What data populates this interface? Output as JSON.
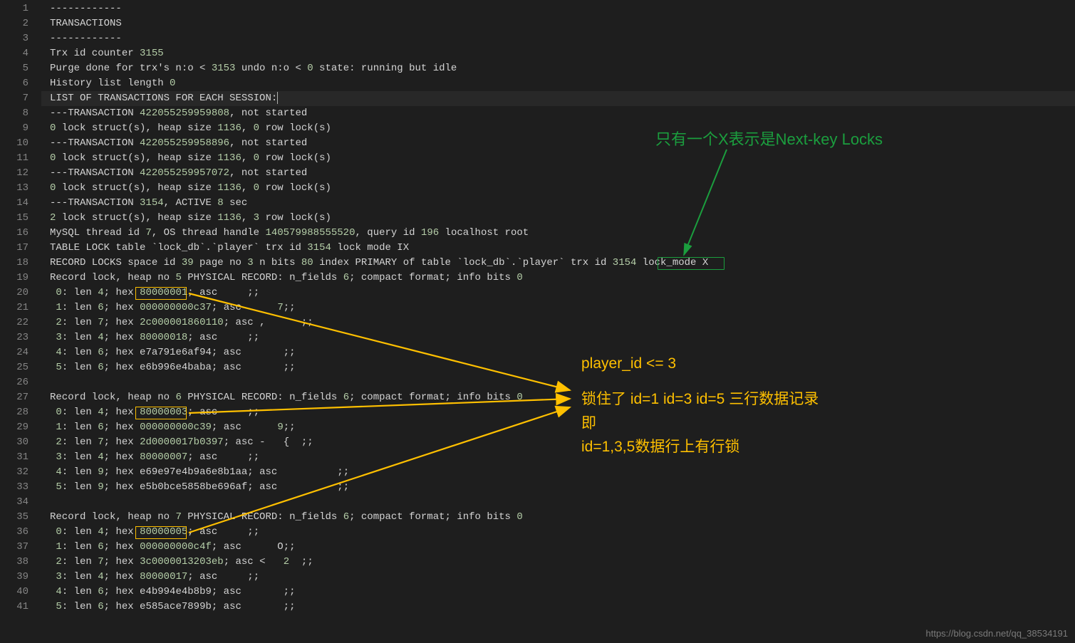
{
  "lines": [
    {
      "n": 1,
      "tokens": [
        {
          "t": "------------",
          "c": "c-default"
        }
      ]
    },
    {
      "n": 2,
      "tokens": [
        {
          "t": "TRANSACTIONS",
          "c": "c-default"
        }
      ]
    },
    {
      "n": 3,
      "tokens": [
        {
          "t": "------------",
          "c": "c-default"
        }
      ]
    },
    {
      "n": 4,
      "tokens": [
        {
          "t": "Trx id counter ",
          "c": "c-default"
        },
        {
          "t": "3155",
          "c": "c-num"
        }
      ]
    },
    {
      "n": 5,
      "tokens": [
        {
          "t": "Purge done for trx's n:o < ",
          "c": "c-default"
        },
        {
          "t": "3153",
          "c": "c-num"
        },
        {
          "t": " undo n:o < ",
          "c": "c-default"
        },
        {
          "t": "0",
          "c": "c-num"
        },
        {
          "t": " state: running but idle",
          "c": "c-default"
        }
      ]
    },
    {
      "n": 6,
      "tokens": [
        {
          "t": "History list length ",
          "c": "c-default"
        },
        {
          "t": "0",
          "c": "c-num"
        }
      ]
    },
    {
      "n": 7,
      "active": true,
      "cursor": true,
      "tokens": [
        {
          "t": "LIST OF TRANSACTIONS FOR EACH SESSION:",
          "c": "c-default"
        }
      ]
    },
    {
      "n": 8,
      "tokens": [
        {
          "t": "---TRANSACTION ",
          "c": "c-default"
        },
        {
          "t": "422055259959808",
          "c": "c-num"
        },
        {
          "t": ", not started",
          "c": "c-default"
        }
      ]
    },
    {
      "n": 9,
      "tokens": [
        {
          "t": "0",
          "c": "c-num"
        },
        {
          "t": " lock struct(s), heap size ",
          "c": "c-default"
        },
        {
          "t": "1136",
          "c": "c-num"
        },
        {
          "t": ", ",
          "c": "c-default"
        },
        {
          "t": "0",
          "c": "c-num"
        },
        {
          "t": " row lock(s)",
          "c": "c-default"
        }
      ]
    },
    {
      "n": 10,
      "tokens": [
        {
          "t": "---TRANSACTION ",
          "c": "c-default"
        },
        {
          "t": "422055259958896",
          "c": "c-num"
        },
        {
          "t": ", not started",
          "c": "c-default"
        }
      ]
    },
    {
      "n": 11,
      "tokens": [
        {
          "t": "0",
          "c": "c-num"
        },
        {
          "t": " lock struct(s), heap size ",
          "c": "c-default"
        },
        {
          "t": "1136",
          "c": "c-num"
        },
        {
          "t": ", ",
          "c": "c-default"
        },
        {
          "t": "0",
          "c": "c-num"
        },
        {
          "t": " row lock(s)",
          "c": "c-default"
        }
      ]
    },
    {
      "n": 12,
      "tokens": [
        {
          "t": "---TRANSACTION ",
          "c": "c-default"
        },
        {
          "t": "422055259957072",
          "c": "c-num"
        },
        {
          "t": ", not started",
          "c": "c-default"
        }
      ]
    },
    {
      "n": 13,
      "tokens": [
        {
          "t": "0",
          "c": "c-num"
        },
        {
          "t": " lock struct(s), heap size ",
          "c": "c-default"
        },
        {
          "t": "1136",
          "c": "c-num"
        },
        {
          "t": ", ",
          "c": "c-default"
        },
        {
          "t": "0",
          "c": "c-num"
        },
        {
          "t": " row lock(s)",
          "c": "c-default"
        }
      ]
    },
    {
      "n": 14,
      "tokens": [
        {
          "t": "---TRANSACTION ",
          "c": "c-default"
        },
        {
          "t": "3154",
          "c": "c-num"
        },
        {
          "t": ", ACTIVE ",
          "c": "c-default"
        },
        {
          "t": "8",
          "c": "c-num"
        },
        {
          "t": " sec",
          "c": "c-default"
        }
      ]
    },
    {
      "n": 15,
      "tokens": [
        {
          "t": "2",
          "c": "c-num"
        },
        {
          "t": " lock struct(s), heap size ",
          "c": "c-default"
        },
        {
          "t": "1136",
          "c": "c-num"
        },
        {
          "t": ", ",
          "c": "c-default"
        },
        {
          "t": "3",
          "c": "c-num"
        },
        {
          "t": " row lock(s)",
          "c": "c-default"
        }
      ]
    },
    {
      "n": 16,
      "tokens": [
        {
          "t": "MySQL thread id ",
          "c": "c-default"
        },
        {
          "t": "7",
          "c": "c-num"
        },
        {
          "t": ", OS thread handle ",
          "c": "c-default"
        },
        {
          "t": "140579988555520",
          "c": "c-num"
        },
        {
          "t": ", query id ",
          "c": "c-default"
        },
        {
          "t": "196",
          "c": "c-num"
        },
        {
          "t": " localhost root",
          "c": "c-default"
        }
      ]
    },
    {
      "n": 17,
      "tokens": [
        {
          "t": "TABLE LOCK table `lock_db`.`player` trx id ",
          "c": "c-default"
        },
        {
          "t": "3154",
          "c": "c-num"
        },
        {
          "t": " lock mode IX",
          "c": "c-default"
        }
      ]
    },
    {
      "n": 18,
      "tokens": [
        {
          "t": "RECORD LOCKS space id ",
          "c": "c-default"
        },
        {
          "t": "39",
          "c": "c-num"
        },
        {
          "t": " page no ",
          "c": "c-default"
        },
        {
          "t": "3",
          "c": "c-num"
        },
        {
          "t": " n bits ",
          "c": "c-default"
        },
        {
          "t": "80",
          "c": "c-num"
        },
        {
          "t": " index PRIMARY of table `lock_db`.`player` trx id ",
          "c": "c-default"
        },
        {
          "t": "3154",
          "c": "c-num"
        },
        {
          "t": " lock_mode X",
          "c": "c-default"
        }
      ]
    },
    {
      "n": 19,
      "tokens": [
        {
          "t": "Record lock, heap no ",
          "c": "c-default"
        },
        {
          "t": "5",
          "c": "c-num"
        },
        {
          "t": " PHYSICAL RECORD: n_fields ",
          "c": "c-default"
        },
        {
          "t": "6",
          "c": "c-num"
        },
        {
          "t": "; compact format; info bits ",
          "c": "c-default"
        },
        {
          "t": "0",
          "c": "c-num"
        }
      ]
    },
    {
      "n": 20,
      "tokens": [
        {
          "t": " ",
          "c": "c-default"
        },
        {
          "t": "0",
          "c": "c-num"
        },
        {
          "t": ": len ",
          "c": "c-default"
        },
        {
          "t": "4",
          "c": "c-num"
        },
        {
          "t": "; hex ",
          "c": "c-default"
        },
        {
          "t": "80000001",
          "c": "c-num"
        },
        {
          "t": "; asc     ;;",
          "c": "c-default"
        }
      ]
    },
    {
      "n": 21,
      "tokens": [
        {
          "t": " ",
          "c": "c-default"
        },
        {
          "t": "1",
          "c": "c-num"
        },
        {
          "t": ": len ",
          "c": "c-default"
        },
        {
          "t": "6",
          "c": "c-num"
        },
        {
          "t": "; hex ",
          "c": "c-default"
        },
        {
          "t": "000000000c37",
          "c": "c-num"
        },
        {
          "t": "; asc      ",
          "c": "c-default"
        },
        {
          "t": "7",
          "c": "c-num"
        },
        {
          "t": ";;",
          "c": "c-default"
        }
      ]
    },
    {
      "n": 22,
      "tokens": [
        {
          "t": " ",
          "c": "c-default"
        },
        {
          "t": "2",
          "c": "c-num"
        },
        {
          "t": ": len ",
          "c": "c-default"
        },
        {
          "t": "7",
          "c": "c-num"
        },
        {
          "t": "; hex ",
          "c": "c-default"
        },
        {
          "t": "2c000001860110",
          "c": "c-num"
        },
        {
          "t": "; asc ,      ;;",
          "c": "c-default"
        }
      ]
    },
    {
      "n": 23,
      "tokens": [
        {
          "t": " ",
          "c": "c-default"
        },
        {
          "t": "3",
          "c": "c-num"
        },
        {
          "t": ": len ",
          "c": "c-default"
        },
        {
          "t": "4",
          "c": "c-num"
        },
        {
          "t": "; hex ",
          "c": "c-default"
        },
        {
          "t": "80000018",
          "c": "c-num"
        },
        {
          "t": "; asc     ;;",
          "c": "c-default"
        }
      ]
    },
    {
      "n": 24,
      "tokens": [
        {
          "t": " ",
          "c": "c-default"
        },
        {
          "t": "4",
          "c": "c-num"
        },
        {
          "t": ": len ",
          "c": "c-default"
        },
        {
          "t": "6",
          "c": "c-num"
        },
        {
          "t": "; hex e7a791e6af94; asc       ;;",
          "c": "c-default"
        }
      ]
    },
    {
      "n": 25,
      "tokens": [
        {
          "t": " ",
          "c": "c-default"
        },
        {
          "t": "5",
          "c": "c-num"
        },
        {
          "t": ": len ",
          "c": "c-default"
        },
        {
          "t": "6",
          "c": "c-num"
        },
        {
          "t": "; hex e6b996e4baba; asc       ;;",
          "c": "c-default"
        }
      ]
    },
    {
      "n": 26,
      "tokens": []
    },
    {
      "n": 27,
      "tokens": [
        {
          "t": "Record lock, heap no ",
          "c": "c-default"
        },
        {
          "t": "6",
          "c": "c-num"
        },
        {
          "t": " PHYSICAL RECORD: n_fields ",
          "c": "c-default"
        },
        {
          "t": "6",
          "c": "c-num"
        },
        {
          "t": "; compact format; info bits ",
          "c": "c-default"
        },
        {
          "t": "0",
          "c": "c-num"
        }
      ]
    },
    {
      "n": 28,
      "tokens": [
        {
          "t": " ",
          "c": "c-default"
        },
        {
          "t": "0",
          "c": "c-num"
        },
        {
          "t": ": len ",
          "c": "c-default"
        },
        {
          "t": "4",
          "c": "c-num"
        },
        {
          "t": "; hex ",
          "c": "c-default"
        },
        {
          "t": "80000003",
          "c": "c-num"
        },
        {
          "t": "; asc     ;;",
          "c": "c-default"
        }
      ]
    },
    {
      "n": 29,
      "tokens": [
        {
          "t": " ",
          "c": "c-default"
        },
        {
          "t": "1",
          "c": "c-num"
        },
        {
          "t": ": len ",
          "c": "c-default"
        },
        {
          "t": "6",
          "c": "c-num"
        },
        {
          "t": "; hex ",
          "c": "c-default"
        },
        {
          "t": "000000000c39",
          "c": "c-num"
        },
        {
          "t": "; asc      ",
          "c": "c-default"
        },
        {
          "t": "9",
          "c": "c-num"
        },
        {
          "t": ";;",
          "c": "c-default"
        }
      ]
    },
    {
      "n": 30,
      "tokens": [
        {
          "t": " ",
          "c": "c-default"
        },
        {
          "t": "2",
          "c": "c-num"
        },
        {
          "t": ": len ",
          "c": "c-default"
        },
        {
          "t": "7",
          "c": "c-num"
        },
        {
          "t": "; hex ",
          "c": "c-default"
        },
        {
          "t": "2d0000017b0397",
          "c": "c-num"
        },
        {
          "t": "; asc -   {  ;;",
          "c": "c-default"
        }
      ]
    },
    {
      "n": 31,
      "tokens": [
        {
          "t": " ",
          "c": "c-default"
        },
        {
          "t": "3",
          "c": "c-num"
        },
        {
          "t": ": len ",
          "c": "c-default"
        },
        {
          "t": "4",
          "c": "c-num"
        },
        {
          "t": "; hex ",
          "c": "c-default"
        },
        {
          "t": "80000007",
          "c": "c-num"
        },
        {
          "t": "; asc     ;;",
          "c": "c-default"
        }
      ]
    },
    {
      "n": 32,
      "tokens": [
        {
          "t": " ",
          "c": "c-default"
        },
        {
          "t": "4",
          "c": "c-num"
        },
        {
          "t": ": len ",
          "c": "c-default"
        },
        {
          "t": "9",
          "c": "c-num"
        },
        {
          "t": "; hex e69e97e4b9a6e8b1aa; asc          ;;",
          "c": "c-default"
        }
      ]
    },
    {
      "n": 33,
      "tokens": [
        {
          "t": " ",
          "c": "c-default"
        },
        {
          "t": "5",
          "c": "c-num"
        },
        {
          "t": ": len ",
          "c": "c-default"
        },
        {
          "t": "9",
          "c": "c-num"
        },
        {
          "t": "; hex e5b0bce5858be696af; asc          ;;",
          "c": "c-default"
        }
      ]
    },
    {
      "n": 34,
      "tokens": []
    },
    {
      "n": 35,
      "tokens": [
        {
          "t": "Record lock, heap no ",
          "c": "c-default"
        },
        {
          "t": "7",
          "c": "c-num"
        },
        {
          "t": " PHYSICAL RECORD: n_fields ",
          "c": "c-default"
        },
        {
          "t": "6",
          "c": "c-num"
        },
        {
          "t": "; compact format; info bits ",
          "c": "c-default"
        },
        {
          "t": "0",
          "c": "c-num"
        }
      ]
    },
    {
      "n": 36,
      "tokens": [
        {
          "t": " ",
          "c": "c-default"
        },
        {
          "t": "0",
          "c": "c-num"
        },
        {
          "t": ": len ",
          "c": "c-default"
        },
        {
          "t": "4",
          "c": "c-num"
        },
        {
          "t": "; hex ",
          "c": "c-default"
        },
        {
          "t": "80000005",
          "c": "c-num"
        },
        {
          "t": "; asc     ;;",
          "c": "c-default"
        }
      ]
    },
    {
      "n": 37,
      "tokens": [
        {
          "t": " ",
          "c": "c-default"
        },
        {
          "t": "1",
          "c": "c-num"
        },
        {
          "t": ": len ",
          "c": "c-default"
        },
        {
          "t": "6",
          "c": "c-num"
        },
        {
          "t": "; hex ",
          "c": "c-default"
        },
        {
          "t": "000000000c4f",
          "c": "c-num"
        },
        {
          "t": "; asc      O;;",
          "c": "c-default"
        }
      ]
    },
    {
      "n": 38,
      "tokens": [
        {
          "t": " ",
          "c": "c-default"
        },
        {
          "t": "2",
          "c": "c-num"
        },
        {
          "t": ": len ",
          "c": "c-default"
        },
        {
          "t": "7",
          "c": "c-num"
        },
        {
          "t": "; hex ",
          "c": "c-default"
        },
        {
          "t": "3c0000013203eb",
          "c": "c-num"
        },
        {
          "t": "; asc <   ",
          "c": "c-default"
        },
        {
          "t": "2",
          "c": "c-num"
        },
        {
          "t": "  ;;",
          "c": "c-default"
        }
      ]
    },
    {
      "n": 39,
      "tokens": [
        {
          "t": " ",
          "c": "c-default"
        },
        {
          "t": "3",
          "c": "c-num"
        },
        {
          "t": ": len ",
          "c": "c-default"
        },
        {
          "t": "4",
          "c": "c-num"
        },
        {
          "t": "; hex ",
          "c": "c-default"
        },
        {
          "t": "80000017",
          "c": "c-num"
        },
        {
          "t": "; asc     ;;",
          "c": "c-default"
        }
      ]
    },
    {
      "n": 40,
      "tokens": [
        {
          "t": " ",
          "c": "c-default"
        },
        {
          "t": "4",
          "c": "c-num"
        },
        {
          "t": ": len ",
          "c": "c-default"
        },
        {
          "t": "6",
          "c": "c-num"
        },
        {
          "t": "; hex e4b994e4b8b9; asc       ;;",
          "c": "c-default"
        }
      ]
    },
    {
      "n": 41,
      "tokens": [
        {
          "t": " ",
          "c": "c-default"
        },
        {
          "t": "5",
          "c": "c-num"
        },
        {
          "t": ": len ",
          "c": "c-default"
        },
        {
          "t": "6",
          "c": "c-num"
        },
        {
          "t": "; hex e585ace7899b; asc       ;;",
          "c": "c-default"
        }
      ]
    }
  ],
  "annotations": {
    "green_label": "只有一个X表示是Next-key Locks",
    "orange_label_1": "player_id <= 3",
    "orange_label_2": "锁住了 id=1 id=3 id=5 三行数据记录",
    "orange_label_3": "即",
    "orange_label_4": "id=1,3,5数据行上有行锁"
  },
  "watermark": "https://blog.csdn.net/qq_38534191"
}
